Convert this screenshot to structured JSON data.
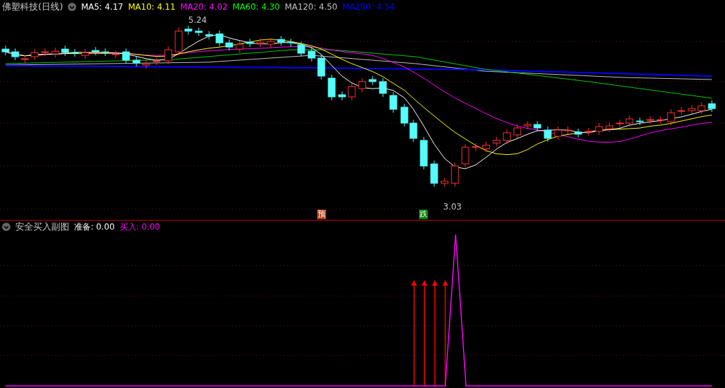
{
  "main_panel": {
    "title": "佛塑科技(日线)",
    "indicators": [
      {
        "label": "MA5: 4.17",
        "color": "#ffffff"
      },
      {
        "label": "MA10: 4.11",
        "color": "#ffff00"
      },
      {
        "label": "MA20: 4.02",
        "color": "#ff00ff"
      },
      {
        "label": "MA60: 4.30",
        "color": "#00ff00"
      },
      {
        "label": "MA120: 4.50",
        "color": "#c0c0c0"
      },
      {
        "label": "MA250: 4.54",
        "color": "#0000ff"
      }
    ],
    "high_label": "5.24",
    "low_label": "3.03",
    "markers": [
      {
        "text": "预",
        "color": "#b5431a"
      },
      {
        "text": "跌",
        "color": "#008000"
      }
    ]
  },
  "sub_panel": {
    "title": "安全买入副图",
    "readings": [
      {
        "label": "准备: 0.00",
        "color": "#ffffff"
      },
      {
        "label": "买入: 0.00",
        "color": "#ff00ff"
      }
    ]
  }
}
